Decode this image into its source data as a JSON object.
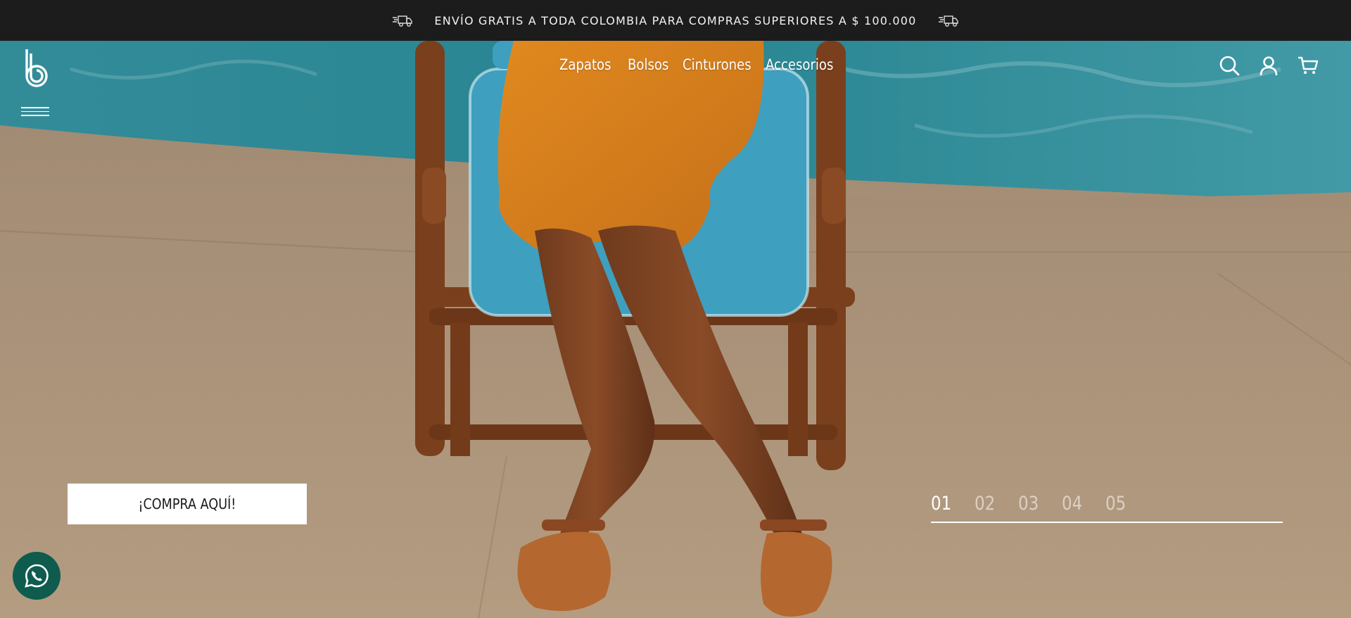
{
  "announcement": {
    "text": "ENVÍO GRATIS A TODA COLOMBIA PARA COMPRAS SUPERIORES A $ 100.000",
    "icon": "truck-icon"
  },
  "header": {
    "logo_icon": "brand-b-logo",
    "menu_icon": "hamburger-menu-icon",
    "nav": [
      {
        "label": "Zapatos"
      },
      {
        "label": "Bolsos"
      },
      {
        "label": "Cinturones"
      },
      {
        "label": "Accesorios"
      }
    ],
    "utilities": [
      "search-icon",
      "user-icon",
      "cart-icon"
    ]
  },
  "hero": {
    "cta_label": "¡COMPRA AQUÍ!",
    "slides": [
      "01",
      "02",
      "03",
      "04",
      "05"
    ],
    "active_slide": "01"
  },
  "floating": {
    "whatsapp_icon": "whatsapp-icon"
  },
  "colors": {
    "topbar_bg": "#1c1c1c",
    "whatsapp_bg": "#0f5c4e",
    "pool": "#3fa6b4",
    "deck": "#c9ad8e"
  }
}
